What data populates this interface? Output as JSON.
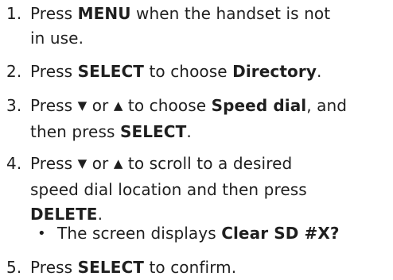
{
  "steps": [
    {
      "num": "1.",
      "lines": [
        [
          "Press ",
          "MENU",
          " when the handset is not"
        ],
        [
          "in use."
        ]
      ]
    },
    {
      "num": "2.",
      "lines": [
        [
          "Press ",
          "SELECT",
          " to choose ",
          "Directory",
          "."
        ]
      ]
    },
    {
      "num": "3.",
      "lines": [
        [
          "Press ",
          "▼",
          " or ",
          "▲",
          " to choose ",
          "Speed dial",
          ", and"
        ],
        [
          "then press ",
          "SELECT",
          "."
        ]
      ]
    },
    {
      "num": "4.",
      "lines": [
        [
          "Press ",
          "▼",
          " or ",
          "▲",
          " to scroll to a desired"
        ],
        [
          "speed dial location and then press"
        ],
        [
          "DELETE",
          "."
        ]
      ]
    },
    {
      "num": "5.",
      "lines": [
        [
          "Press ",
          "SELECT",
          " to confirm."
        ]
      ]
    }
  ],
  "sub_bullet": {
    "bullet": "•",
    "parts": [
      "The screen displays ",
      "Clear SD #X?"
    ]
  }
}
